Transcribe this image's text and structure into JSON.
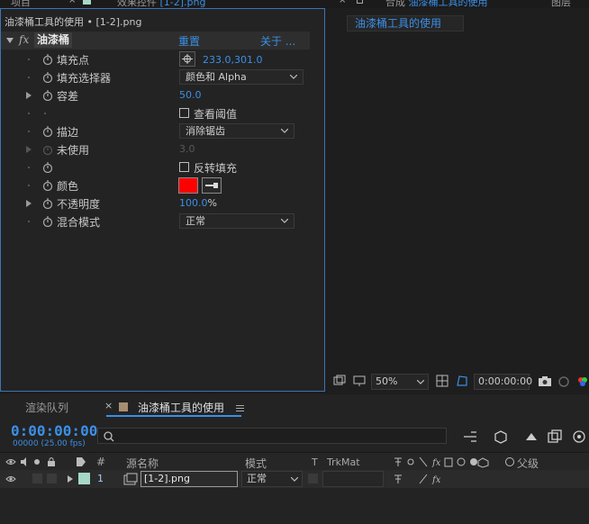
{
  "top_tabs": {
    "left_partial": "项目",
    "fx_partial": "效果控件",
    "fx_partial_file": "[1-2].png",
    "comp_partial": "合成",
    "comp_partial_name": "油漆桶工具的使用",
    "right_partial": "图层"
  },
  "fx_panel": {
    "breadcrumb": "油漆桶工具的使用 • [1-2].png",
    "effect_name": "油漆桶",
    "reset_label": "重置",
    "about_label": "关于 ...",
    "fill_point": {
      "label": "填充点",
      "value": "233.0,301.0"
    },
    "fill_selector": {
      "label": "填充选择器",
      "value": "颜色和 Alpha"
    },
    "tolerance": {
      "label": "容差",
      "value": "50.0"
    },
    "view_threshold": {
      "label": "查看阈值"
    },
    "stroke": {
      "label": "描边",
      "value": "消除锯齿"
    },
    "unused": {
      "label": "未使用",
      "value": "3.0"
    },
    "invert_fill": {
      "label": "反转填充"
    },
    "color": {
      "label": "颜色",
      "swatch": "#ff0000"
    },
    "opacity": {
      "label": "不透明度",
      "value": "100.0",
      "unit": "%"
    },
    "blend_mode": {
      "label": "混合模式",
      "value": "正常"
    }
  },
  "comp_panel": {
    "tab_label": "油漆桶工具的使用",
    "zoom": "50%",
    "timecode": "0:00:00:00"
  },
  "timeline": {
    "render_queue_tab": "渲染队列",
    "comp_tab": "油漆桶工具的使用",
    "current_time": "0:00:00:00",
    "frame_info": "00000 (25.00 fps)",
    "columns": {
      "num": "#",
      "source_name": "源名称",
      "mode": "模式",
      "t": "T",
      "trkmat": "TrkMat",
      "parent": "父级"
    },
    "layers": [
      {
        "index": "1",
        "name": "[1-2].png",
        "mode": "正常"
      }
    ]
  },
  "colors": {
    "accent_blue": "#3b8fe6",
    "panel_border": "#3e74b5",
    "label_color": "#a6d8c8"
  }
}
